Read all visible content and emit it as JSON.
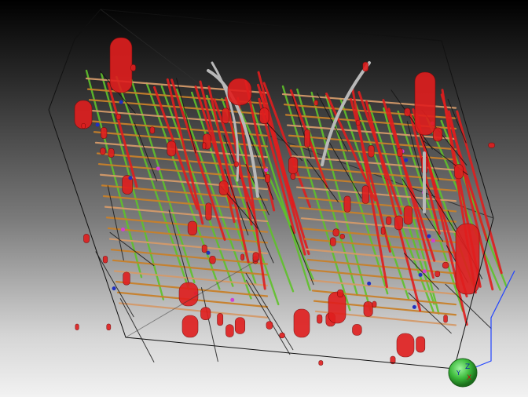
{
  "viewport": {
    "icon": "3d-model-icon",
    "background_colors": [
      "#000000",
      "#f2f2f2"
    ]
  },
  "colors": {
    "pipe_red": "#e01e1e",
    "pipe_green": "#5fc22a",
    "pipe_orange": "#c8802a",
    "pipe_grey": "#b8b8b8",
    "pipe_tan": "#d49a6a",
    "valve_magenta": "#d040d0",
    "valve_blue": "#2030c0",
    "bounding_box": "#111111",
    "triad_green": "#3ab83a",
    "dimension_blue": "#2244ff"
  },
  "triad": {
    "icon": "orientation-triad-icon",
    "axis_labels": [
      "X",
      "Y",
      "Z"
    ]
  }
}
